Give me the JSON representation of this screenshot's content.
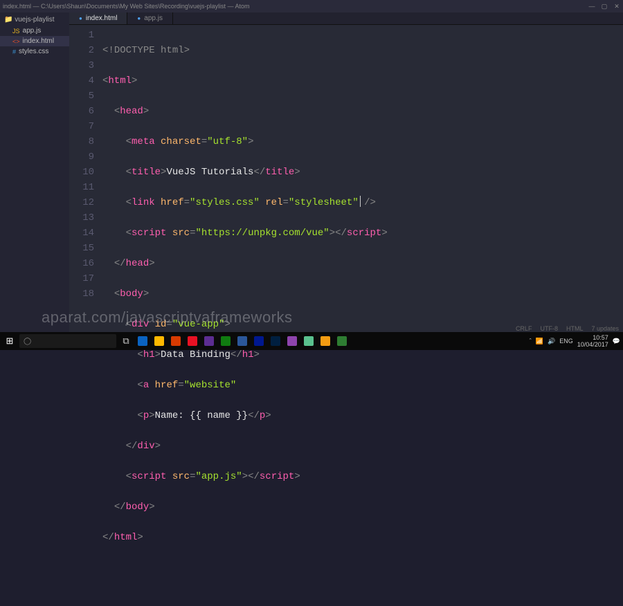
{
  "window": {
    "title": "index.html — C:\\Users\\Shaun\\Documents\\My Web Sites\\Recording\\vuejs-playlist — Atom",
    "min": "—",
    "max": "▢",
    "close": "✕"
  },
  "sidebar": {
    "project": "vuejs-playlist",
    "items": [
      {
        "label": "app.js"
      },
      {
        "label": "index.html"
      },
      {
        "label": "styles.css"
      }
    ]
  },
  "tabs": [
    {
      "label": "index.html",
      "active": true
    },
    {
      "label": "app.js",
      "active": false
    }
  ],
  "gutter": [
    "1",
    "2",
    "3",
    "4",
    "5",
    "6",
    "7",
    "8",
    "9",
    "10",
    "11",
    "12",
    "13",
    "14",
    "15",
    "16",
    "17",
    "18"
  ],
  "code": {
    "l1": {
      "open": "<!",
      "name": "DOCTYPE html",
      "close": ">"
    },
    "l2": {
      "open": "<",
      "name": "html",
      "close": ">"
    },
    "l3": {
      "open": "<",
      "name": "head",
      "close": ">"
    },
    "l4": {
      "open": "<",
      "name": "meta",
      "a1": "charset",
      "v1": "\"utf-8\"",
      "close": ">"
    },
    "l5": {
      "open": "<",
      "name": "title",
      "close": ">",
      "text": "VueJS Tutorials",
      "open2": "</",
      "name2": "title",
      "close2": ">"
    },
    "l6": {
      "open": "<",
      "name": "link",
      "a1": "href",
      "v1": "\"styles.css\"",
      "a2": "rel",
      "v2": "\"stylesheet\"",
      "close": " />"
    },
    "l7": {
      "open": "<",
      "name": "script",
      "a1": "src",
      "v1": "\"https://unpkg.com/vue\"",
      "close": ">",
      "open2": "</",
      "name2": "script",
      "close2": ">"
    },
    "l8": {
      "open": "</",
      "name": "head",
      "close": ">"
    },
    "l9": {
      "open": "<",
      "name": "body",
      "close": ">"
    },
    "l10": {
      "open": "<",
      "name": "div",
      "a1": "id",
      "v1": "\"vue-app\"",
      "close": ">"
    },
    "l11": {
      "open": "<",
      "name": "h1",
      "close": ">",
      "text": "Data Binding",
      "open2": "</",
      "name2": "h1",
      "close2": ">"
    },
    "l12": {
      "open": "<",
      "name": "a",
      "a1": "href",
      "v1": "\"website\""
    },
    "l13": {
      "open": "<",
      "name": "p",
      "close": ">",
      "text": "Name: {{ name }}",
      "open2": "</",
      "name2": "p",
      "close2": ">"
    },
    "l14": {
      "open": "</",
      "name": "div",
      "close": ">"
    },
    "l15": {
      "open": "<",
      "name": "script",
      "a1": "src",
      "v1": "\"app.js\"",
      "close": ">",
      "open2": "</",
      "name2": "script",
      "close2": ">"
    },
    "l16": {
      "open": "</",
      "name": "body",
      "close": ">"
    },
    "l17": {
      "open": "</",
      "name": "html",
      "close": ">"
    }
  },
  "statusbar": {
    "crlf": "CRLF",
    "encoding": "UTF-8",
    "lang": "HTML",
    "updates": "7 updates"
  },
  "watermark": "aparat.com/javascriptvaframeworks",
  "taskbar": {
    "search_placeholder": "",
    "lang": "ENG",
    "time": "10:57",
    "date": "10/04/2017"
  }
}
